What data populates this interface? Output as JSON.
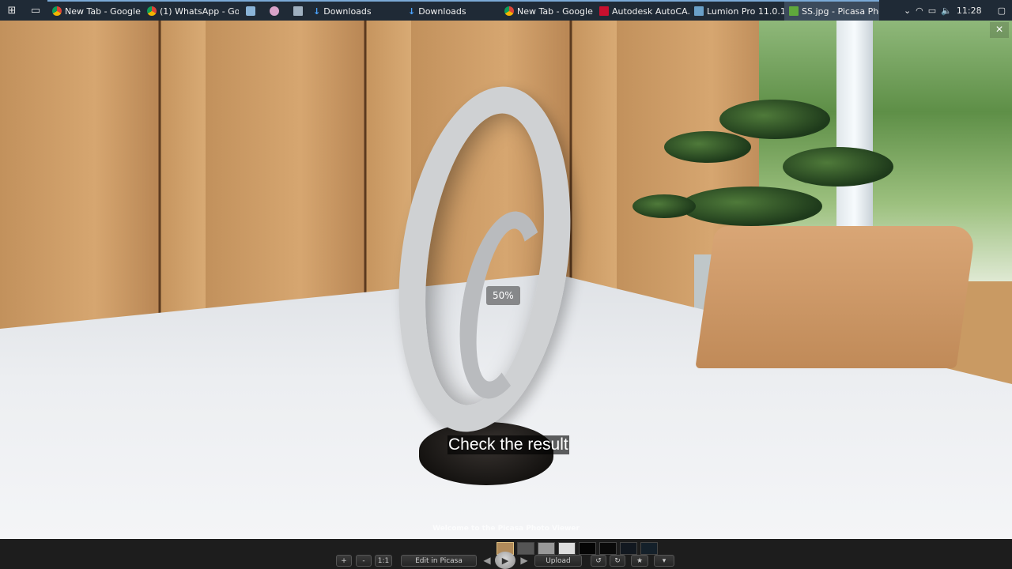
{
  "taskbar": {
    "tasks": [
      {
        "label": "New Tab - Google ...",
        "icon": "chrome-icon"
      },
      {
        "label": "(1) WhatsApp - Go...",
        "icon": "chrome-icon"
      },
      {
        "label": "",
        "icon": "app-icon-1"
      },
      {
        "label": "",
        "icon": "app-icon-2"
      },
      {
        "label": "",
        "icon": "calculator-icon"
      },
      {
        "label": "Downloads",
        "icon": "download-arrow-icon"
      },
      {
        "label": "Downloads",
        "icon": "download-arrow-icon"
      },
      {
        "label": "New Tab - Google ...",
        "icon": "chrome-icon"
      },
      {
        "label": "Autodesk AutoCA...",
        "icon": "autocad-icon"
      },
      {
        "label": "Lumion Pro 11.0.1...",
        "icon": "lumion-icon"
      },
      {
        "label": "SS.jpg - Picasa Pho...",
        "icon": "picasa-icon"
      }
    ],
    "clock": "11:28"
  },
  "viewer": {
    "zoom": "50%",
    "caption": "Check the result",
    "welcome": "Welcome to the Picasa Photo Viewer",
    "close": "×"
  },
  "toolbar": {
    "zoom_in": "+",
    "zoom_out": "-",
    "actual_size": "1:1",
    "edit": "Edit in Picasa",
    "upload": "Upload",
    "prev": "◀",
    "next": "▶",
    "play": "▶",
    "rotate_left": "↺",
    "rotate_right": "↻",
    "star": "★",
    "more": "▾"
  },
  "colors": {
    "taskbar_bg": "#1f2a36",
    "task_accent": "#7aa9d6",
    "toolbar_bg": "#1d1d1d"
  }
}
